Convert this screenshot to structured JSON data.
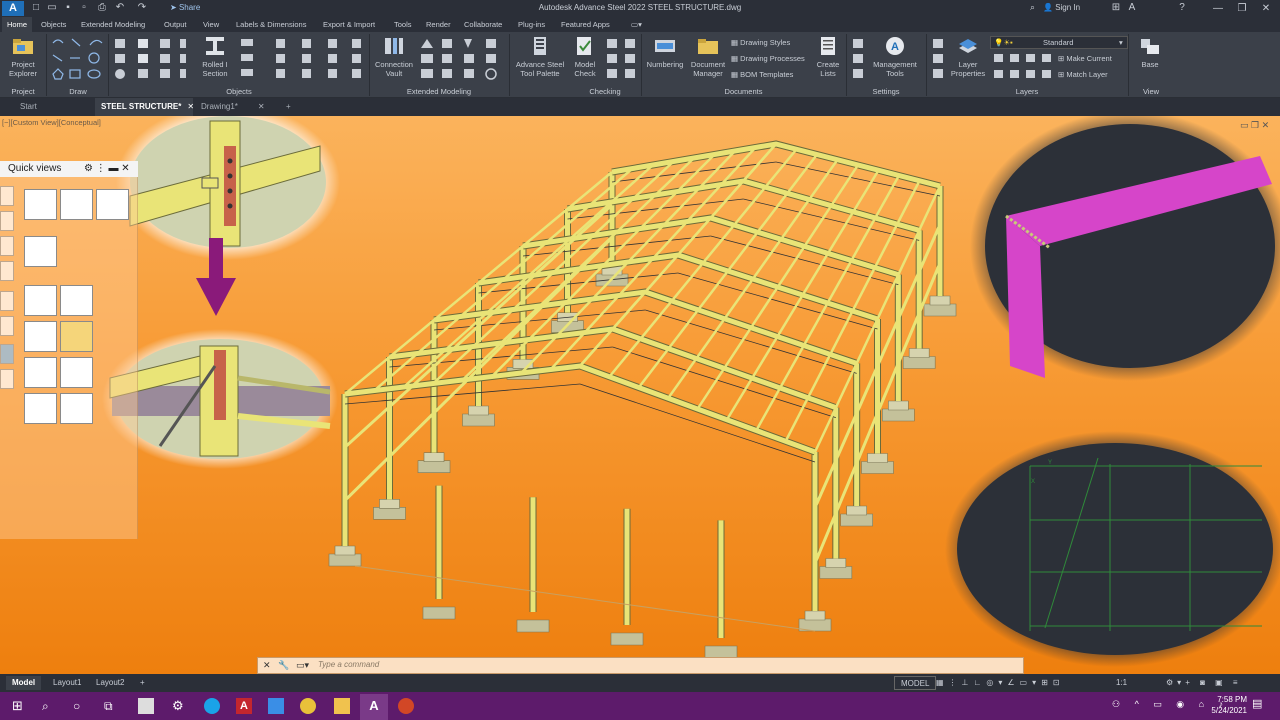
{
  "titlebar": {
    "app_icon": "A",
    "share_label": "Share",
    "title": "Autodesk Advance Steel 2022    STEEL STRUCTURE.dwg",
    "sign_in": "Sign In"
  },
  "ribbon_tabs": [
    "Home",
    "Objects",
    "Extended Modeling",
    "Output",
    "View",
    "Labels & Dimensions",
    "Export & Import",
    "Tools",
    "Render",
    "Collaborate",
    "Plug-ins",
    "Featured Apps"
  ],
  "ribbon": {
    "project_explorer": "Project Explorer",
    "rolled_i_section": "Rolled I Section",
    "connection_vault": "Connection Vault",
    "advance_steel_tool_palette": "Advance Steel Tool Palette",
    "model_check": "Model Check",
    "numbering": "Numbering",
    "document_manager": "Document Manager",
    "drawing_styles": "Drawing Styles",
    "drawing_processes": "Drawing Processes",
    "bom_templates": "BOM Templates",
    "create_lists": "Create Lists",
    "management_tools": "Management Tools",
    "layer_properties": "Layer Properties",
    "layer_current": "Standard",
    "make_current": "Make Current",
    "match_layer": "Match Layer",
    "base": "Base",
    "panels": {
      "project": "Project",
      "draw": "Draw",
      "objects": "Objects",
      "extended_modeling": "Extended Modeling",
      "checking": "Checking",
      "documents": "Documents",
      "settings": "Settings",
      "layers": "Layers",
      "view": "View"
    }
  },
  "doc_tabs": [
    "Start",
    "STEEL STRUCTURE*",
    "Drawing1*"
  ],
  "viewport": {
    "label": "[−][Custom View][Conceptual]",
    "quick_views_title": "Quick views",
    "command_placeholder": "Type a command"
  },
  "layout_tabs": [
    "Model",
    "Layout1",
    "Layout2"
  ],
  "status": {
    "model": "MODEL",
    "scale": "1:1"
  },
  "clock": {
    "time": "7:58 PM",
    "date": "5/24/2021"
  },
  "colors": {
    "steel": "#e9e477",
    "magenta_member": "#d645c9",
    "taskbar": "#5d1b6b"
  }
}
